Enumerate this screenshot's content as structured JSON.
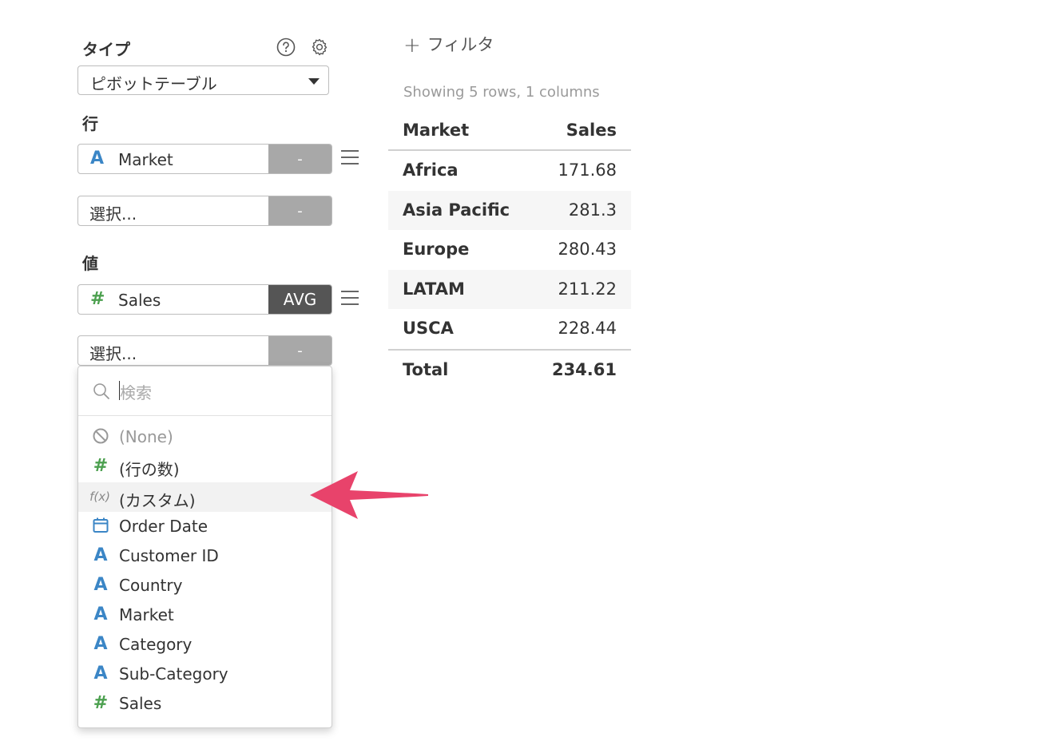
{
  "settings": {
    "type_label": "タイプ",
    "type_value": "ピボットテーブル",
    "rows_label": "行",
    "values_label": "値",
    "help_icon": "question-circle-icon",
    "gear_icon": "gear-icon"
  },
  "rows": {
    "field1": {
      "icon": "A",
      "name": "Market",
      "btn": "-"
    },
    "field2": {
      "placeholder": "選択...",
      "btn": "-"
    }
  },
  "values": {
    "field1": {
      "icon": "#",
      "name": "Sales",
      "btn": "AVG"
    },
    "field2": {
      "placeholder": "選択...",
      "btn": "-"
    }
  },
  "dropdown": {
    "search_placeholder": "検索",
    "items": [
      {
        "icon": "none-icon",
        "label": "(None)"
      },
      {
        "icon": "#",
        "label": "(行の数)"
      },
      {
        "icon": "f(x)",
        "label": "(カスタム)"
      },
      {
        "icon": "calendar-icon",
        "label": "Order Date"
      },
      {
        "icon": "A",
        "label": "Customer ID"
      },
      {
        "icon": "A",
        "label": "Country"
      },
      {
        "icon": "A",
        "label": "Market"
      },
      {
        "icon": "A",
        "label": "Category"
      },
      {
        "icon": "A",
        "label": "Sub-Category"
      },
      {
        "icon": "#",
        "label": "Sales"
      }
    ]
  },
  "filter": {
    "plus": "+",
    "label": "フィルタ"
  },
  "summary": "Showing 5 rows, 1 columns",
  "table": {
    "headers": [
      "Market",
      "Sales"
    ],
    "rows": [
      [
        "Africa",
        "171.68"
      ],
      [
        "Asia Pacific",
        "281.3"
      ],
      [
        "Europe",
        "280.43"
      ],
      [
        "LATAM",
        "211.22"
      ],
      [
        "USCA",
        "228.44"
      ]
    ],
    "total": [
      "Total",
      "234.61"
    ]
  },
  "colors": {
    "accent_arrow": "#e8436b",
    "string_icon": "#3b86c6",
    "number_icon": "#4ca04f",
    "agg_button": "#555555"
  }
}
